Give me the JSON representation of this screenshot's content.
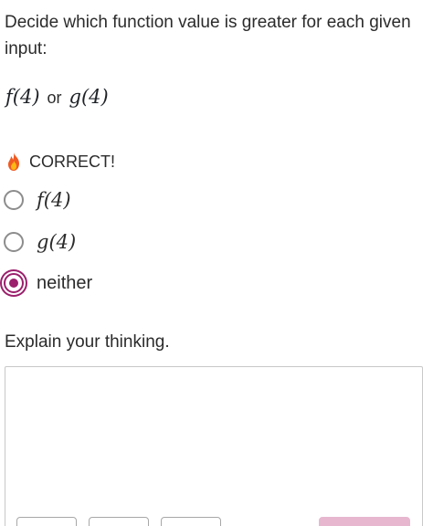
{
  "question": {
    "text": "Decide which function value is greater for each given input:"
  },
  "prompt": {
    "left": "f(4)",
    "or_label": "or",
    "right": "g(4)"
  },
  "feedback": {
    "icon": "flame-icon",
    "text": "CORRECT!"
  },
  "choices": [
    {
      "label": "f(4)",
      "selected": false
    },
    {
      "label": "g(4)",
      "selected": false
    },
    {
      "label": "neither",
      "selected": true
    }
  ],
  "explain": {
    "label": "Explain your thinking.",
    "value": ""
  },
  "colors": {
    "accent": "#9b1f6c",
    "button_primary": "#e7b7cf"
  }
}
